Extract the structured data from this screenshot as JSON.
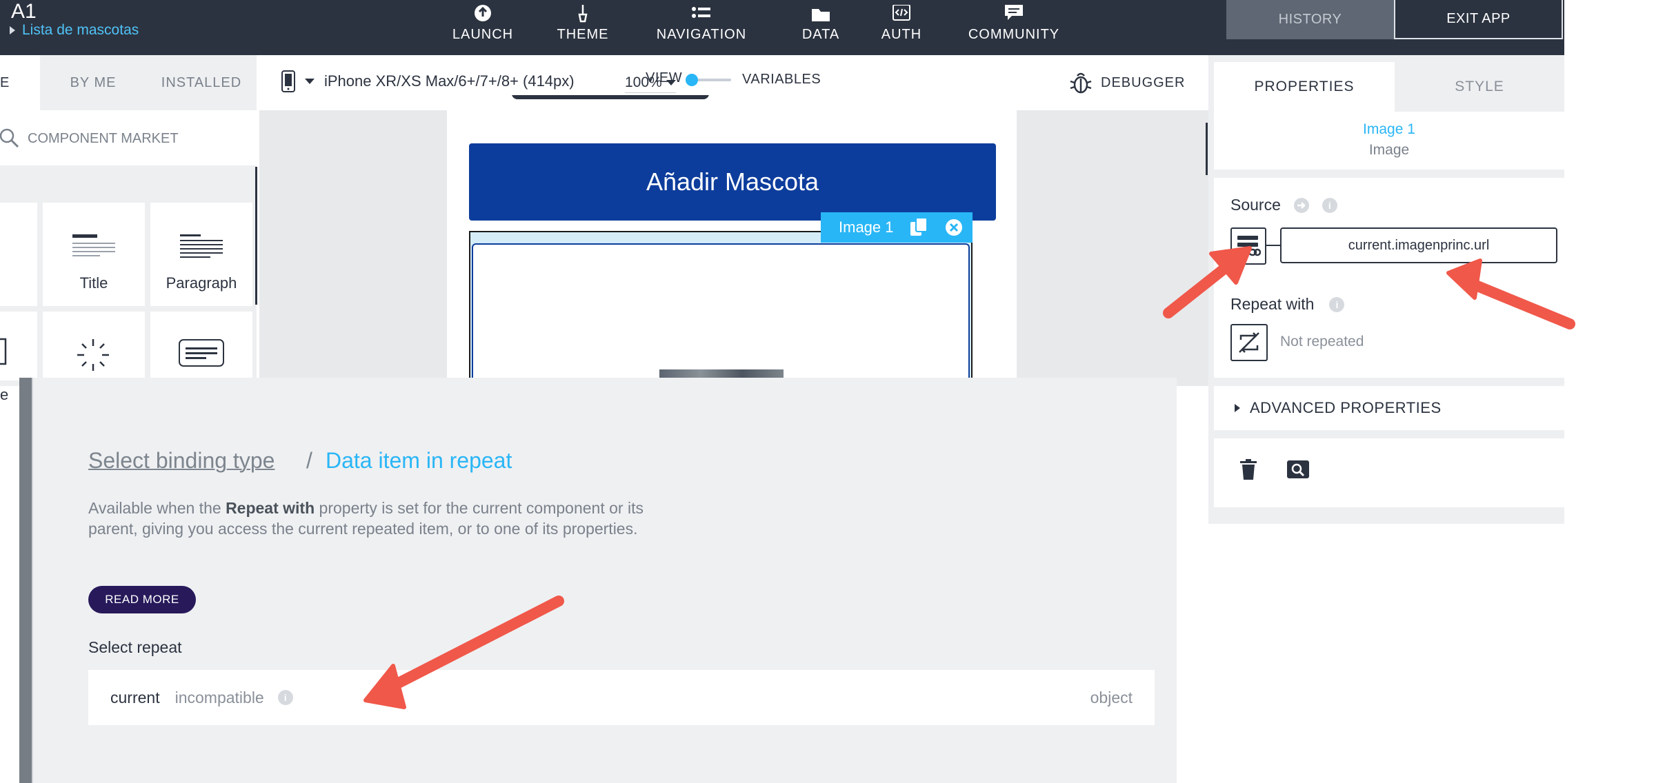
{
  "app": {
    "name": "A1",
    "screen": "Lista de mascotas"
  },
  "nav": [
    {
      "label": "LAUNCH",
      "icon": "launch-icon"
    },
    {
      "label": "THEME",
      "icon": "theme-brush-icon"
    },
    {
      "label": "NAVIGATION",
      "icon": "navigation-list-icon"
    },
    {
      "label": "DATA",
      "icon": "data-folder-icon"
    },
    {
      "label": "AUTH",
      "icon": "auth-code-icon"
    },
    {
      "label": "COMMUNITY",
      "icon": "community-chat-icon"
    }
  ],
  "header_buttons": {
    "history": "HISTORY",
    "exit": "EXIT APP"
  },
  "left_panel": {
    "tabs": [
      "E",
      "BY ME",
      "INSTALLED"
    ],
    "market_placeholder": "COMPONENT MARKET",
    "components": [
      "Title",
      "Paragraph"
    ],
    "partial_label": "e"
  },
  "toolbar": {
    "device": "iPhone XR/XS Max/6+/7+/8+ (414px)",
    "zoom": "100%",
    "view": "VIEW",
    "variables": "VARIABLES",
    "debugger": "DEBUGGER"
  },
  "canvas": {
    "add_button": "Añadir Mascota",
    "image_tag": "Image 1"
  },
  "properties": {
    "tabs": {
      "properties": "PROPERTIES",
      "style": "STYLE"
    },
    "component_name": "Image 1",
    "component_type": "Image",
    "source_label": "Source",
    "source_value": "current.imagenprinc.url",
    "repeat_label": "Repeat with",
    "repeat_value": "Not repeated",
    "advanced": "ADVANCED PROPERTIES"
  },
  "binding_panel": {
    "breadcrumb_link": "Select binding type",
    "breadcrumb_sep": "/",
    "breadcrumb_current": "Data item in repeat",
    "desc_before": "Available when the ",
    "desc_bold": "Repeat with",
    "desc_after": " property is set for the current component or its parent, giving you access the current repeated item, or to one of its properties.",
    "read_more": "READ MORE",
    "select_repeat_label": "Select repeat",
    "row": {
      "name": "current",
      "status": "incompatible",
      "type": "object"
    }
  },
  "colors": {
    "topbar": "#2c3340",
    "accent": "#29b6f6",
    "primary_button": "#0d3d9c",
    "read_more": "#27195a",
    "arrow": "#f0584a"
  }
}
